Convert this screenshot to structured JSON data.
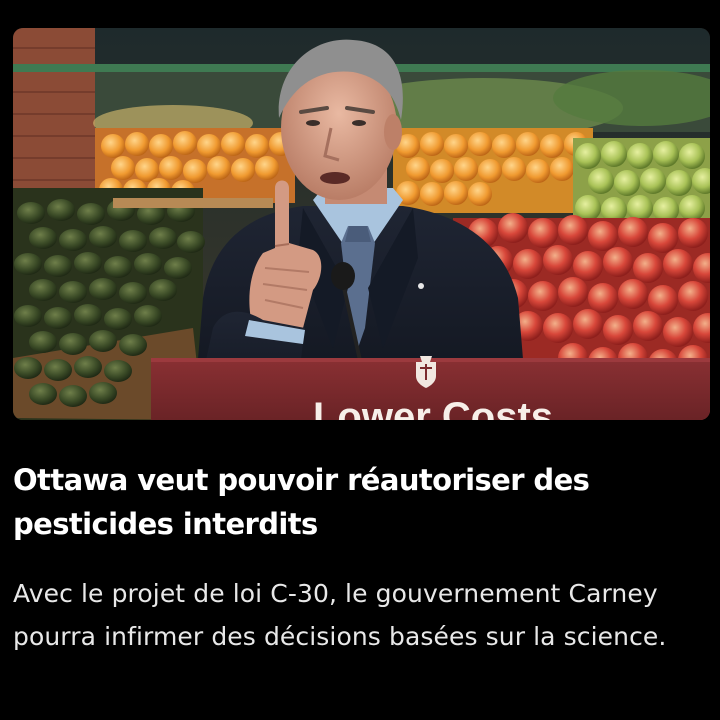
{
  "article": {
    "headline": "Ottawa veut pouvoir réautoriser des pesticides interdits",
    "summary": "Avec le projet de loi C-30, le gouvernement Carney pourra infirmer des décisions basées sur la science."
  },
  "photo": {
    "podium_text": "Lower Costs"
  },
  "colors": {
    "background": "#000000",
    "headline_text": "#ffffff",
    "summary_text": "#e8e8e8",
    "podium": "#7a2a2d"
  }
}
